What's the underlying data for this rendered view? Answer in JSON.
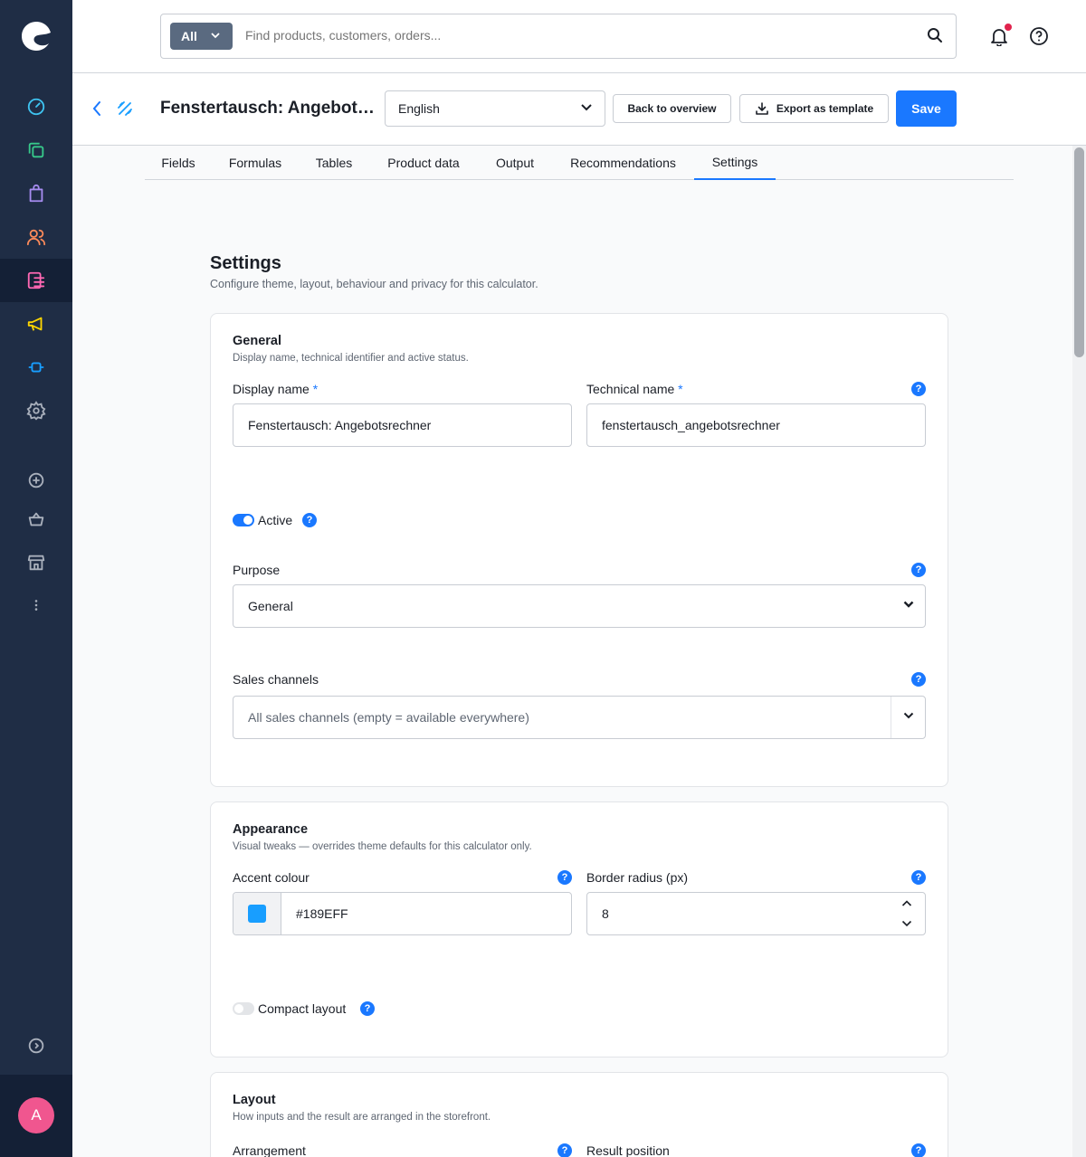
{
  "sidebar": {
    "items": [
      "dashboard",
      "catalogues",
      "orders",
      "customers",
      "content",
      "marketing",
      "extensions",
      "settings",
      "add",
      "basket",
      "sales-channel",
      "more"
    ],
    "avatar_letter": "A"
  },
  "search": {
    "type_label": "All",
    "placeholder": "Find products, customers, orders..."
  },
  "header": {
    "title": "Fenstertausch: Angebotsr...",
    "language": "English",
    "back_label": "Back to overview",
    "export_label": "Export as template",
    "save_label": "Save"
  },
  "tabs": [
    "Fields",
    "Formulas",
    "Tables",
    "Product data",
    "Output",
    "Recommendations",
    "Settings"
  ],
  "settings": {
    "title": "Settings",
    "subtitle": "Configure theme, layout, behaviour and privacy for this calculator.",
    "general": {
      "title": "General",
      "subtitle": "Display name, technical identifier and active status.",
      "display_name_label": "Display name",
      "display_name_value": "Fenstertausch: Angebotsrechner",
      "technical_name_label": "Technical name",
      "technical_name_value": "fenstertausch_angebotsrechner",
      "required_mark": "*",
      "active_label": "Active",
      "active_on": true,
      "purpose_label": "Purpose",
      "purpose_value": "General",
      "sales_channels_label": "Sales channels",
      "sales_channels_placeholder": "All sales channels (empty = available everywhere)"
    },
    "appearance": {
      "title": "Appearance",
      "subtitle": "Visual tweaks — overrides theme defaults for this calculator only.",
      "accent_label": "Accent colour",
      "accent_value": "#189EFF",
      "radius_label": "Border radius (px)",
      "radius_value": "8",
      "compact_label": "Compact layout",
      "compact_on": false
    },
    "layout": {
      "title": "Layout",
      "subtitle": "How inputs and the result are arranged in the storefront.",
      "arrangement_label": "Arrangement",
      "result_position_label": "Result position"
    }
  },
  "help_mark": "?",
  "colors": {
    "sidebar_bg": "#1f2d45",
    "primary": "#1a78ff",
    "accent_swatch": "#189EFF"
  }
}
